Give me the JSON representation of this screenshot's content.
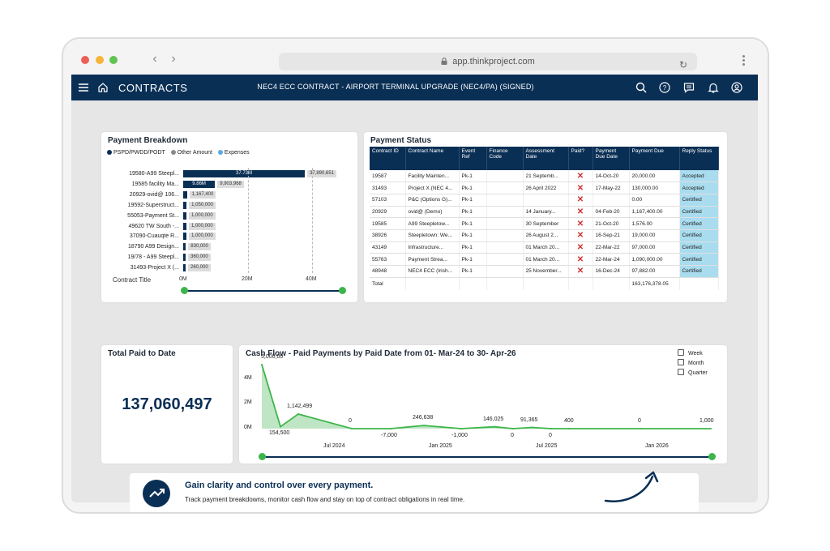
{
  "browser": {
    "url": "app.thinkproject.com"
  },
  "app": {
    "section_title": "CONTRACTS",
    "contract_title": "NEC4 ECC CONTRACT - AIRPORT TERMINAL UPGRADE (NEC4/PA) (SIGNED)",
    "brand_color": "#0a2f55",
    "accent_color": "#3cb54a"
  },
  "payment_breakdown": {
    "title": "Payment Breakdown",
    "legend": [
      {
        "label": "PSPD/PWDD/PODT",
        "color": "#0a2f55"
      },
      {
        "label": "Other Amount",
        "color": "#8a8a8a"
      },
      {
        "label": "Expenses",
        "color": "#5aa9e6"
      }
    ],
    "axis_title": "Contract Title",
    "axis_ticks": [
      "0M",
      "20M",
      "40M"
    ],
    "chart_data": {
      "type": "bar",
      "categories": [
        "19580-A99 Steepl...",
        "19585 facility Ma...",
        "20929-ovid@ 106...",
        "19592-Superstruct...",
        "55053-Payment St...",
        "49620 TW South -...",
        "37090-Cuauqte R...",
        "18790 A99 Design...",
        "19/78 - A99 Steepl...",
        "31493-Project X (..."
      ],
      "series": [
        {
          "name": "PSPD/PWDD/PODT",
          "values": [
            37730000,
            9860000,
            1167400,
            1050000,
            1000000,
            1000000,
            1000000,
            830000,
            360000,
            260000
          ]
        }
      ],
      "bar_labels": [
        "37.73M",
        "9.86M",
        "",
        "",
        "",
        "",
        "",
        "",
        "",
        ""
      ],
      "totals": [
        "37,890,651",
        "9,903,968",
        "1,167,400",
        "1,050,000",
        "1,000,000",
        "1,000,000",
        "1,000,000",
        "830,000",
        "360,000",
        "260,000"
      ],
      "xlim": [
        0,
        50000000
      ]
    }
  },
  "payment_status": {
    "title": "Payment Status",
    "columns": [
      "Contract ID",
      "Contract Name",
      "Event Ref",
      "Finance Code",
      "Assessment Date",
      "Paid?",
      "Payment Due Date",
      "Payment Due",
      "Reply Status"
    ],
    "rows": [
      [
        "19587",
        "Facility Mainten...",
        "Pk-1",
        "",
        "21 Septemb...",
        "✕",
        "14-Oct-20",
        "20,000.00",
        "Accepted"
      ],
      [
        "31493",
        "Project X (NEC 4...",
        "Pk-1",
        "",
        "26 April 2022",
        "✕",
        "17-May-22",
        "130,000.00",
        "Accepted"
      ],
      [
        "57103",
        "P&C (Options G)...",
        "Pk-1",
        "",
        "",
        "✕",
        "",
        "0.00",
        "Certified"
      ],
      [
        "20929",
        "ovid@ (Demo)",
        "Pk-1",
        "",
        "14 January...",
        "✕",
        "04-Feb-20",
        "1,167,400.00",
        "Certified"
      ],
      [
        "19585",
        "A99 Steepletow...",
        "Pk-1",
        "",
        "30 September",
        "✕",
        "21-Oct-20",
        "1,576.00",
        "Certified"
      ],
      [
        "38926",
        "Steepletown: We...",
        "Pk-1",
        "",
        "26 August 2...",
        "✕",
        "16-Sep-21",
        "19,000.00",
        "Certified"
      ],
      [
        "43149",
        "Infrastructure...",
        "Pk-1",
        "",
        "01 March 20...",
        "✕",
        "22-Mar-22",
        "97,000.00",
        "Certified"
      ],
      [
        "55763",
        "Payment Strea...",
        "Pk-1",
        "",
        "01 March 20...",
        "✕",
        "22-Mar-24",
        "1,090,000.00",
        "Certified"
      ],
      [
        "48948",
        "NEC4 ECC (Irish...",
        "Pk-1",
        "",
        "25 November...",
        "✕",
        "16-Dec-24",
        "97,882.00",
        "Certified"
      ]
    ],
    "total_label": "Total",
    "total_value": "163,176,378.05"
  },
  "total_paid": {
    "title": "Total Paid to Date",
    "value": "137,060,497"
  },
  "cash_flow": {
    "title": "Cash Flow - Paid Payments by Paid Date from 01- Mar-24 to 30- Apr-26",
    "options": [
      "Week",
      "Month",
      "Quarter"
    ],
    "chart_data": {
      "type": "area",
      "y_ticks": [
        "4M",
        "2M",
        "0M"
      ],
      "x_ticks": [
        "Jul 2024",
        "Jan 2025",
        "Jul 2025",
        "Jan 2026"
      ],
      "ylim": [
        0,
        5000000
      ],
      "points": [
        {
          "label": "5,000,00",
          "value": 5000000
        },
        {
          "label": "154,500",
          "value": 154500
        },
        {
          "label": "1,142,499",
          "value": 1142499
        },
        {
          "label": "0",
          "value": 0
        },
        {
          "label": "-7,000",
          "value": -7000
        },
        {
          "label": "246,638",
          "value": 246638
        },
        {
          "label": "-1,000",
          "value": -1000
        },
        {
          "label": "146,025",
          "value": 146025
        },
        {
          "label": "0",
          "value": 0
        },
        {
          "label": "91,365",
          "value": 91365
        },
        {
          "label": "0",
          "value": 0
        },
        {
          "label": "400",
          "value": 400
        },
        {
          "label": "0",
          "value": 0
        },
        {
          "label": "1,000",
          "value": 1000
        }
      ]
    }
  },
  "banner": {
    "heading": "Gain clarity and control over every payment.",
    "text": "Track payment breakdowns, monitor cash flow and stay on top of contract obligations in real time."
  }
}
